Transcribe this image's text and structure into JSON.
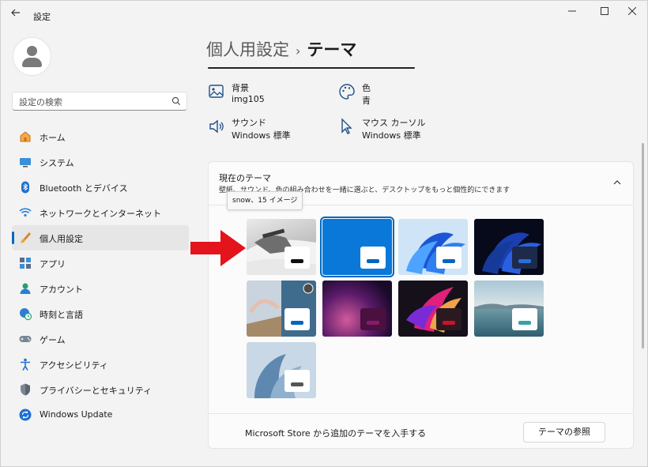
{
  "window": {
    "title": "設定",
    "back_icon": "arrow-left-icon",
    "minimize_icon": "minimize-icon",
    "maximize_icon": "maximize-icon",
    "close_icon": "close-icon"
  },
  "search": {
    "placeholder": "設定の検索",
    "icon": "search-icon"
  },
  "sidebar": {
    "items": [
      {
        "label": "ホーム",
        "icon": "home-icon"
      },
      {
        "label": "システム",
        "icon": "monitor-icon"
      },
      {
        "label": "Bluetooth とデバイス",
        "icon": "bluetooth-icon"
      },
      {
        "label": "ネットワークとインターネット",
        "icon": "wifi-icon"
      },
      {
        "label": "個人用設定",
        "icon": "paintbrush-icon",
        "selected": true
      },
      {
        "label": "アプリ",
        "icon": "apps-icon"
      },
      {
        "label": "アカウント",
        "icon": "account-icon"
      },
      {
        "label": "時刻と言語",
        "icon": "globe-clock-icon"
      },
      {
        "label": "ゲーム",
        "icon": "gamepad-icon"
      },
      {
        "label": "アクセシビリティ",
        "icon": "accessibility-icon"
      },
      {
        "label": "プライバシーとセキュリティ",
        "icon": "shield-icon"
      },
      {
        "label": "Windows Update",
        "icon": "update-icon"
      }
    ]
  },
  "breadcrumb": {
    "parent": "個人用設定",
    "separator": "›",
    "current": "テーマ"
  },
  "properties": {
    "background": {
      "label": "背景",
      "value": "img105",
      "icon": "picture-icon"
    },
    "color": {
      "label": "色",
      "value": "青",
      "icon": "palette-icon"
    },
    "sound": {
      "label": "サウンド",
      "value": "Windows 標準",
      "icon": "speaker-icon"
    },
    "cursor": {
      "label": "マウス カーソル",
      "value": "Windows 標準",
      "icon": "cursor-icon"
    }
  },
  "current_theme": {
    "title": "現在のテーマ",
    "description": "壁紙、サウンド、色の組み合わせを一緒に選ぶと、デスクトップをもっと個性的にできます",
    "tooltip": "snow、15 イメージ",
    "chevron_icon": "chevron-up-icon",
    "themes": [
      {
        "name": "snow",
        "style": "snow",
        "chip_bg": "#ffffff",
        "chip_bar": "#111111"
      },
      {
        "name": "windows-light",
        "style": "blue-solid",
        "chip_bg": "#ffffff",
        "chip_bar": "#0067c0",
        "selected": true
      },
      {
        "name": "windows-bloom-light",
        "style": "bloom-light",
        "chip_bg": "#ffffff",
        "chip_bar": "#0067c0"
      },
      {
        "name": "windows-bloom-dark",
        "style": "bloom-dark",
        "chip_bg": "#1e2a4a",
        "chip_bar": "#2a6fd6"
      },
      {
        "name": "spotlight",
        "style": "spotlight",
        "chip_bg": "#ffffff",
        "chip_bar": "#0067c0"
      },
      {
        "name": "glow",
        "style": "glow",
        "chip_bg": "#4a1040",
        "chip_bar": "#8a1a6a"
      },
      {
        "name": "captured-motion",
        "style": "captured-motion",
        "chip_bg": "#2a1a20",
        "chip_bar": "#d0102a"
      },
      {
        "name": "sunrise",
        "style": "lake",
        "chip_bg": "#ffffff",
        "chip_bar": "#3aa0a8"
      },
      {
        "name": "flow",
        "style": "flow",
        "chip_bg": "#ffffff",
        "chip_bar": "#555555"
      }
    ],
    "store_text": "Microsoft Store から追加のテーマを入手する",
    "browse_button": "テーマの参照"
  },
  "annotation": {
    "icon": "red-arrow-icon",
    "color": "#e3141c"
  }
}
